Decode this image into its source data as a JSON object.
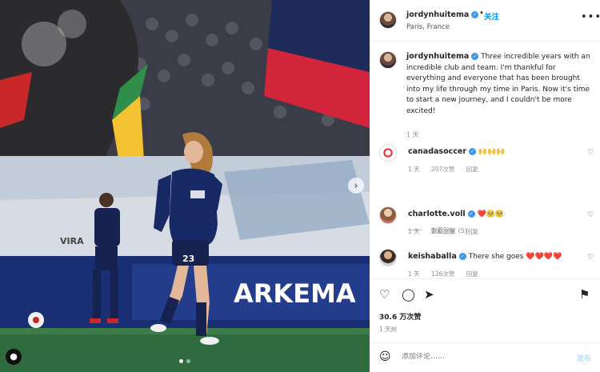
{
  "post": {
    "username": "jordynhuitema",
    "follow_label": "关注",
    "separator": "•",
    "location": "Paris, France",
    "more_label": "•••",
    "caption": "Three incredible years with an incredible club and team. I'm thankful for everything and everyone that has been brought into my life through my time in Paris. Now it's time to start a new journey, and I couldn't be more excited!",
    "caption_age": "1 天"
  },
  "photo": {
    "jersey_number": "23",
    "sponsor_text": "ARKEMA",
    "back_text": "VIRA",
    "slide_count": 2,
    "active_slide": 0
  },
  "comments": [
    {
      "username": "canadasoccer",
      "verified": true,
      "text": "🙌🙌🙌",
      "age": "1 天",
      "likes": "207次赞",
      "reply": "回复"
    },
    {
      "username": "charlotte.voll",
      "verified": true,
      "text": "❤️🥺🥺",
      "age": "1 天",
      "likes": "100次赞",
      "reply": "回复"
    },
    {
      "username": "keishaballa",
      "verified": true,
      "text": "There she goes ❤️❤️❤️❤️",
      "age": "1 天",
      "likes": "126次赞",
      "reply": "回复"
    }
  ],
  "view_replies": "查看回复 (5)",
  "actions": {
    "likes_count": "30.6 万次赞",
    "posted_ago": "1 天前"
  },
  "add_comment": {
    "placeholder": "添加评论……",
    "post_label": "发布"
  },
  "colors": {
    "accent": "#0095f6",
    "verified": "#3897f0",
    "heart_red": "#ed4956"
  }
}
